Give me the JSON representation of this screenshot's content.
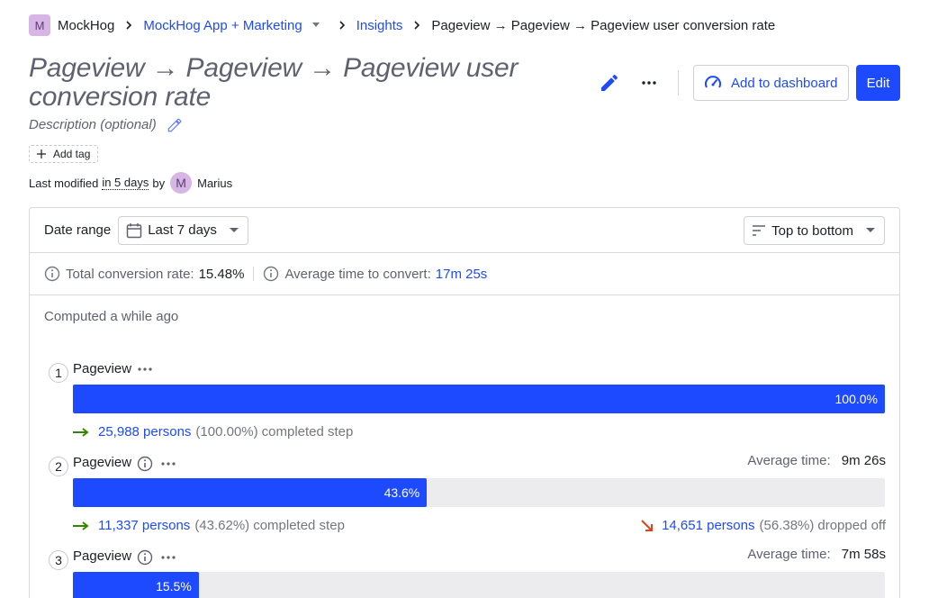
{
  "breadcrumb": {
    "org_initial": "M",
    "org": "MockHog",
    "project": "MockHog App + Marketing",
    "section": "Insights",
    "current": "Pageview → Pageview → Pageview user conversion rate"
  },
  "header": {
    "title": "Pageview → Pageview → Pageview user conversion rate",
    "description_placeholder": "Description (optional)",
    "add_to_dashboard_label": "Add to dashboard",
    "edit_label": "Edit",
    "add_tag_label": "Add tag"
  },
  "modified": {
    "prefix": "Last modified",
    "when": "in 5 days",
    "by": "by",
    "user_initial": "M",
    "user_name": "Marius"
  },
  "filters": {
    "date_range_label": "Date range",
    "date_range_value": "Last 7 days",
    "order_value": "Top to bottom"
  },
  "stats": {
    "total_label": "Total conversion rate:",
    "total_value": "15.48%",
    "avg_label": "Average time to convert:",
    "avg_value": "17m 25s"
  },
  "computed_text": "Computed a while ago",
  "steps": [
    {
      "num": "1",
      "name": "Pageview",
      "bar_pct": 100.0,
      "bar_label": "100.0%",
      "persons": "25,988 persons",
      "persons_pct": "(100.00%)",
      "completed_note": "completed step"
    },
    {
      "num": "2",
      "name": "Pageview",
      "avg_label": "Average time:",
      "avg_value": "9m 26s",
      "bar_pct": 43.6,
      "bar_label": "43.6%",
      "persons": "11,337 persons",
      "persons_pct": "(43.62%)",
      "completed_note": "completed step",
      "dropped_persons": "14,651 persons",
      "dropped_pct": "(56.38%)",
      "dropped_note": "dropped off"
    },
    {
      "num": "3",
      "name": "Pageview",
      "avg_label": "Average time:",
      "avg_value": "7m 58s",
      "bar_pct": 15.5,
      "bar_label": "15.5%"
    }
  ],
  "colors": {
    "accent": "#1d4aff",
    "completed_arrow": "#388600",
    "dropped_arrow": "#e0421a",
    "avatar_bg": "#d7b6e6"
  }
}
